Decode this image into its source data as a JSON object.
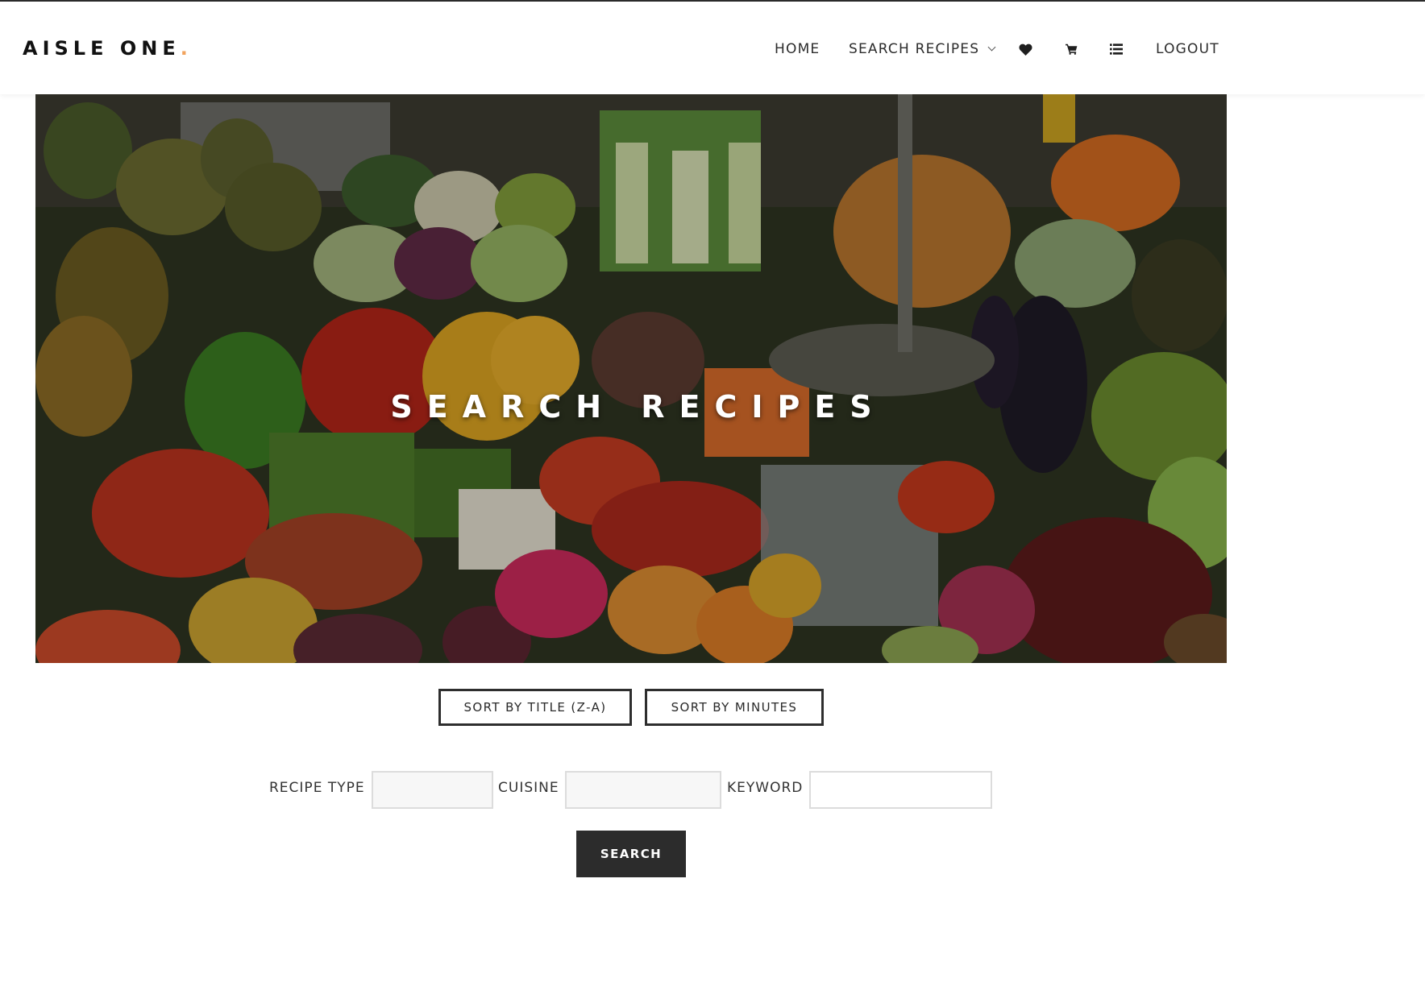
{
  "brand": {
    "name": "AISLE ONE",
    "dot": ".",
    "dot_color": "#f2a35e"
  },
  "nav": {
    "home": "HOME",
    "search_recipes": "SEARCH RECIPES",
    "favorites_icon": "heart-icon",
    "cart_icon": "cart-icon",
    "list_icon": "list-icon",
    "logout": "LOGOUT"
  },
  "hero": {
    "title": "SEARCH RECIPES"
  },
  "sort": {
    "title_label": "SORT BY TITLE (Z-A)",
    "minutes_label": "SORT BY MINUTES"
  },
  "filters": {
    "recipe_type_label": "RECIPE TYPE",
    "recipe_type_value": "",
    "cuisine_label": "CUISINE",
    "cuisine_value": "",
    "keyword_label": "KEYWORD",
    "keyword_value": ""
  },
  "search_button": "SEARCH",
  "colors": {
    "dark": "#2c2c2c",
    "accent": "#f2a35e"
  }
}
